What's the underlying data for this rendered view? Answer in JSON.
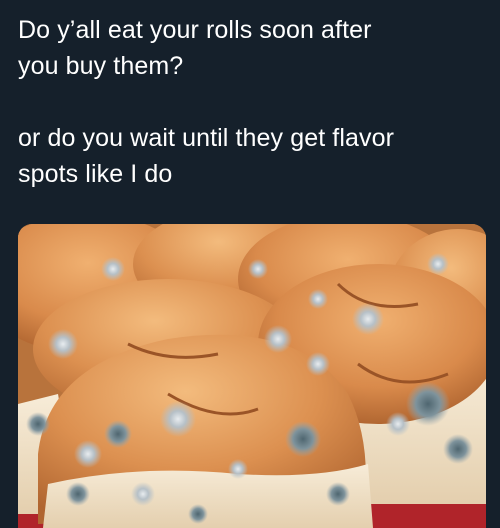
{
  "tweet": {
    "line1": "Do y’all eat your rolls soon after",
    "line2": "you buy them?",
    "line3": "or do you wait until they get flavor",
    "line4": "spots like I do"
  },
  "media": {
    "subject": "moldy-bread-rolls-photo",
    "colors": {
      "background": "#15202b",
      "crust": "#d9894a",
      "crumb": "#f2e3cc",
      "mold": "#8c97a0"
    }
  }
}
